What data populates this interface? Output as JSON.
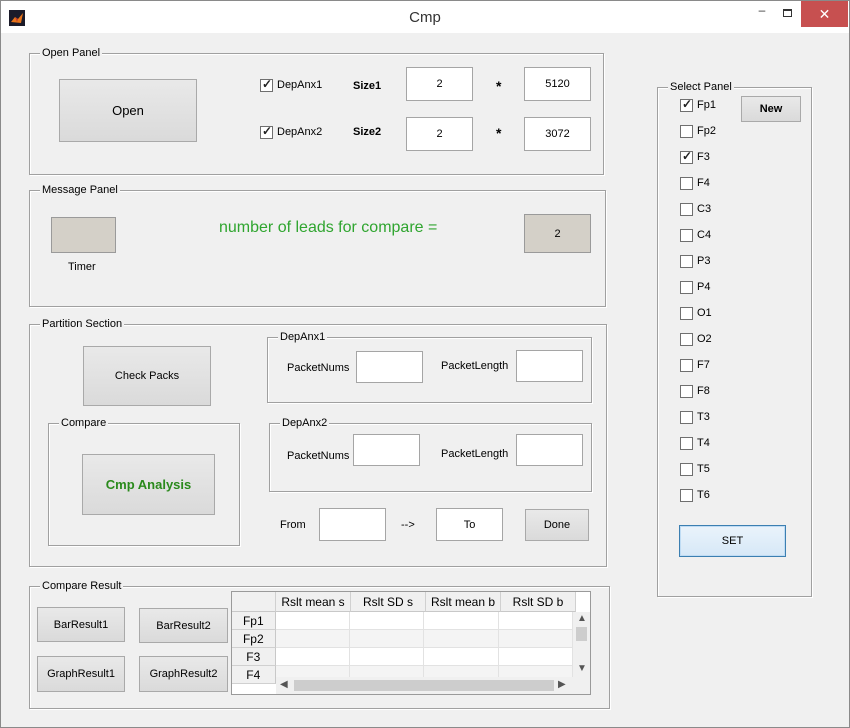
{
  "window": {
    "title": "Cmp",
    "minimize": "–",
    "close": "✕"
  },
  "open_panel": {
    "title": "Open Panel",
    "open_label": "Open",
    "dep1": {
      "label": "DepAnx1",
      "checked": true,
      "size_label": "Size1",
      "a": "2",
      "times": "*",
      "b": "5120"
    },
    "dep2": {
      "label": "DepAnx2",
      "checked": true,
      "size_label": "Size2",
      "a": "2",
      "times": "*",
      "b": "3072"
    }
  },
  "message_panel": {
    "title": "Message Panel",
    "timer_label": "Timer",
    "message": "number of leads for compare =",
    "count": "2"
  },
  "partition": {
    "title": "Partition Section",
    "check_packs": "Check Packs",
    "compare_title": "Compare",
    "cmp_analysis": "Cmp Analysis",
    "dep1": {
      "title": "DepAnx1",
      "packet_nums": "PacketNums",
      "packet_length": "PacketLength",
      "nums_value": "",
      "length_value": ""
    },
    "dep2": {
      "title": "DepAnx2",
      "packet_nums": "PacketNums",
      "packet_length": "PacketLength",
      "nums_value": "",
      "length_value": ""
    },
    "from_label": "From",
    "from_value": "",
    "arrow": "-->",
    "to_value": "To",
    "done": "Done"
  },
  "compare_result": {
    "title": "Compare Result",
    "bar1": "BarResult1",
    "bar2": "BarResult2",
    "graph1": "GraphResult1",
    "graph2": "GraphResult2",
    "columns": [
      "Rslt mean s",
      "Rslt SD s",
      "Rslt mean b",
      "Rslt SD b"
    ],
    "rows": [
      "Fp1",
      "Fp2",
      "F3",
      "F4"
    ]
  },
  "select_panel": {
    "title": "Select Panel",
    "new_label": "New",
    "set_label": "SET",
    "channels": [
      {
        "label": "Fp1",
        "checked": true
      },
      {
        "label": "Fp2",
        "checked": false
      },
      {
        "label": "F3",
        "checked": true
      },
      {
        "label": "F4",
        "checked": false
      },
      {
        "label": "C3",
        "checked": false
      },
      {
        "label": "C4",
        "checked": false
      },
      {
        "label": "P3",
        "checked": false
      },
      {
        "label": "P4",
        "checked": false
      },
      {
        "label": "O1",
        "checked": false
      },
      {
        "label": "O2",
        "checked": false
      },
      {
        "label": "F7",
        "checked": false
      },
      {
        "label": "F8",
        "checked": false
      },
      {
        "label": "T3",
        "checked": false
      },
      {
        "label": "T4",
        "checked": false
      },
      {
        "label": "T5",
        "checked": false
      },
      {
        "label": "T6",
        "checked": false
      }
    ]
  },
  "colors": {
    "message_green": "#2fa52f",
    "cmp_green": "#2a8a1c",
    "close_red": "#c75050"
  }
}
